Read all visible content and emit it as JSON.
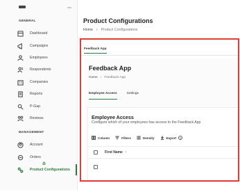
{
  "sidebar": {
    "sections": [
      {
        "label": "GENERAL",
        "items": [
          {
            "label": "Dashboard",
            "icon": "dashboard-icon"
          },
          {
            "label": "Campaigns",
            "icon": "megaphone-icon"
          },
          {
            "label": "Employees",
            "icon": "person-icon"
          },
          {
            "label": "Respondents",
            "icon": "respondents-icon"
          },
          {
            "label": "Companies",
            "icon": "building-icon"
          },
          {
            "label": "Reports",
            "icon": "report-icon"
          },
          {
            "label": "P-Gap",
            "icon": "pgap-icon"
          },
          {
            "label": "Reviews",
            "icon": "reviews-icon"
          }
        ]
      },
      {
        "label": "MANAGEMENT",
        "items": [
          {
            "label": "Account",
            "icon": "account-icon"
          },
          {
            "label": "Orders",
            "icon": "orders-icon",
            "badge": "lock-icon"
          },
          {
            "label": "Product Configurations",
            "icon": "product-config-icon",
            "active": true
          }
        ]
      }
    ]
  },
  "header": {
    "title": "Product Configurations",
    "breadcrumb": [
      "Home",
      "›",
      "Product Configurations"
    ]
  },
  "embed": {
    "tab_label": "Feedback App",
    "app_title": "Feedback App",
    "breadcrumb": [
      "Home",
      "›",
      "Feedback App"
    ],
    "tabs": [
      {
        "label": "Employee Access",
        "active": true
      },
      {
        "label": "Settings",
        "active": false
      }
    ],
    "card": {
      "title": "Employee Access",
      "subtitle": "Configure which of your employees has access to the Feedback App",
      "toolbar": [
        {
          "label": "Column",
          "icon": "columns-icon"
        },
        {
          "label": "Filters",
          "icon": "filter-icon"
        },
        {
          "label": "Density",
          "icon": "density-icon"
        },
        {
          "label": "Export",
          "icon": "export-icon"
        }
      ],
      "help_glyph": "?",
      "columns": [
        {
          "label": "First Name",
          "sort": "↑"
        }
      ]
    }
  },
  "colors": {
    "accent": "#2b7a3b",
    "highlight_border": "#e53935"
  }
}
